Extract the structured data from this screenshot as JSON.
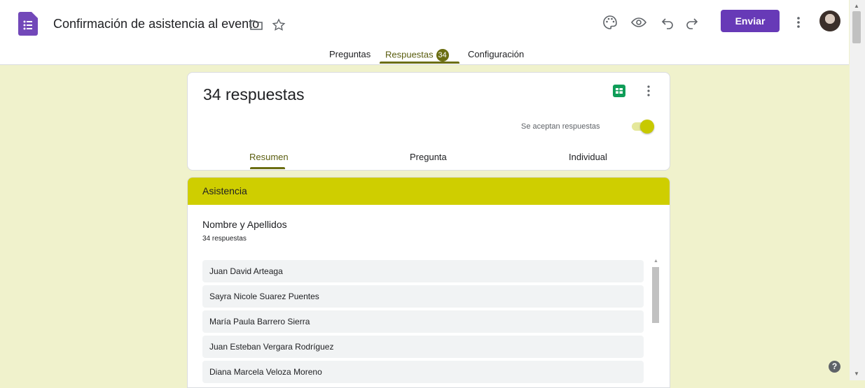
{
  "app": {
    "doc_title": "Confirmación de asistencia al evento",
    "icons": [
      "forms-logo-icon",
      "folder-icon",
      "star-icon",
      "palette-icon",
      "preview-eye-icon",
      "undo-icon",
      "redo-icon",
      "more-vert-icon"
    ],
    "send_label": "Enviar"
  },
  "tabs": {
    "questions": "Preguntas",
    "responses": "Respuestas",
    "responses_count": "34",
    "settings": "Configuración"
  },
  "summary": {
    "title": "34 respuestas",
    "accepting_label": "Se aceptan respuestas",
    "accepting_on": true,
    "subtabs": [
      "Resumen",
      "Pregunta",
      "Individual"
    ]
  },
  "section": {
    "title": "Asistencia",
    "question": "Nombre y Apellidos",
    "count": "34 respuestas",
    "responses": [
      "Juan David Arteaga",
      "Sayra Nicole Suarez Puentes",
      "María Paula Barrero Sierra",
      "Juan Esteban Vergara Rodríguez",
      "Diana Marcela Veloza Moreno"
    ]
  },
  "help": "?",
  "colors": {
    "accent": "#673ab7",
    "theme": "#cfce00",
    "background": "#f0f2cc"
  }
}
